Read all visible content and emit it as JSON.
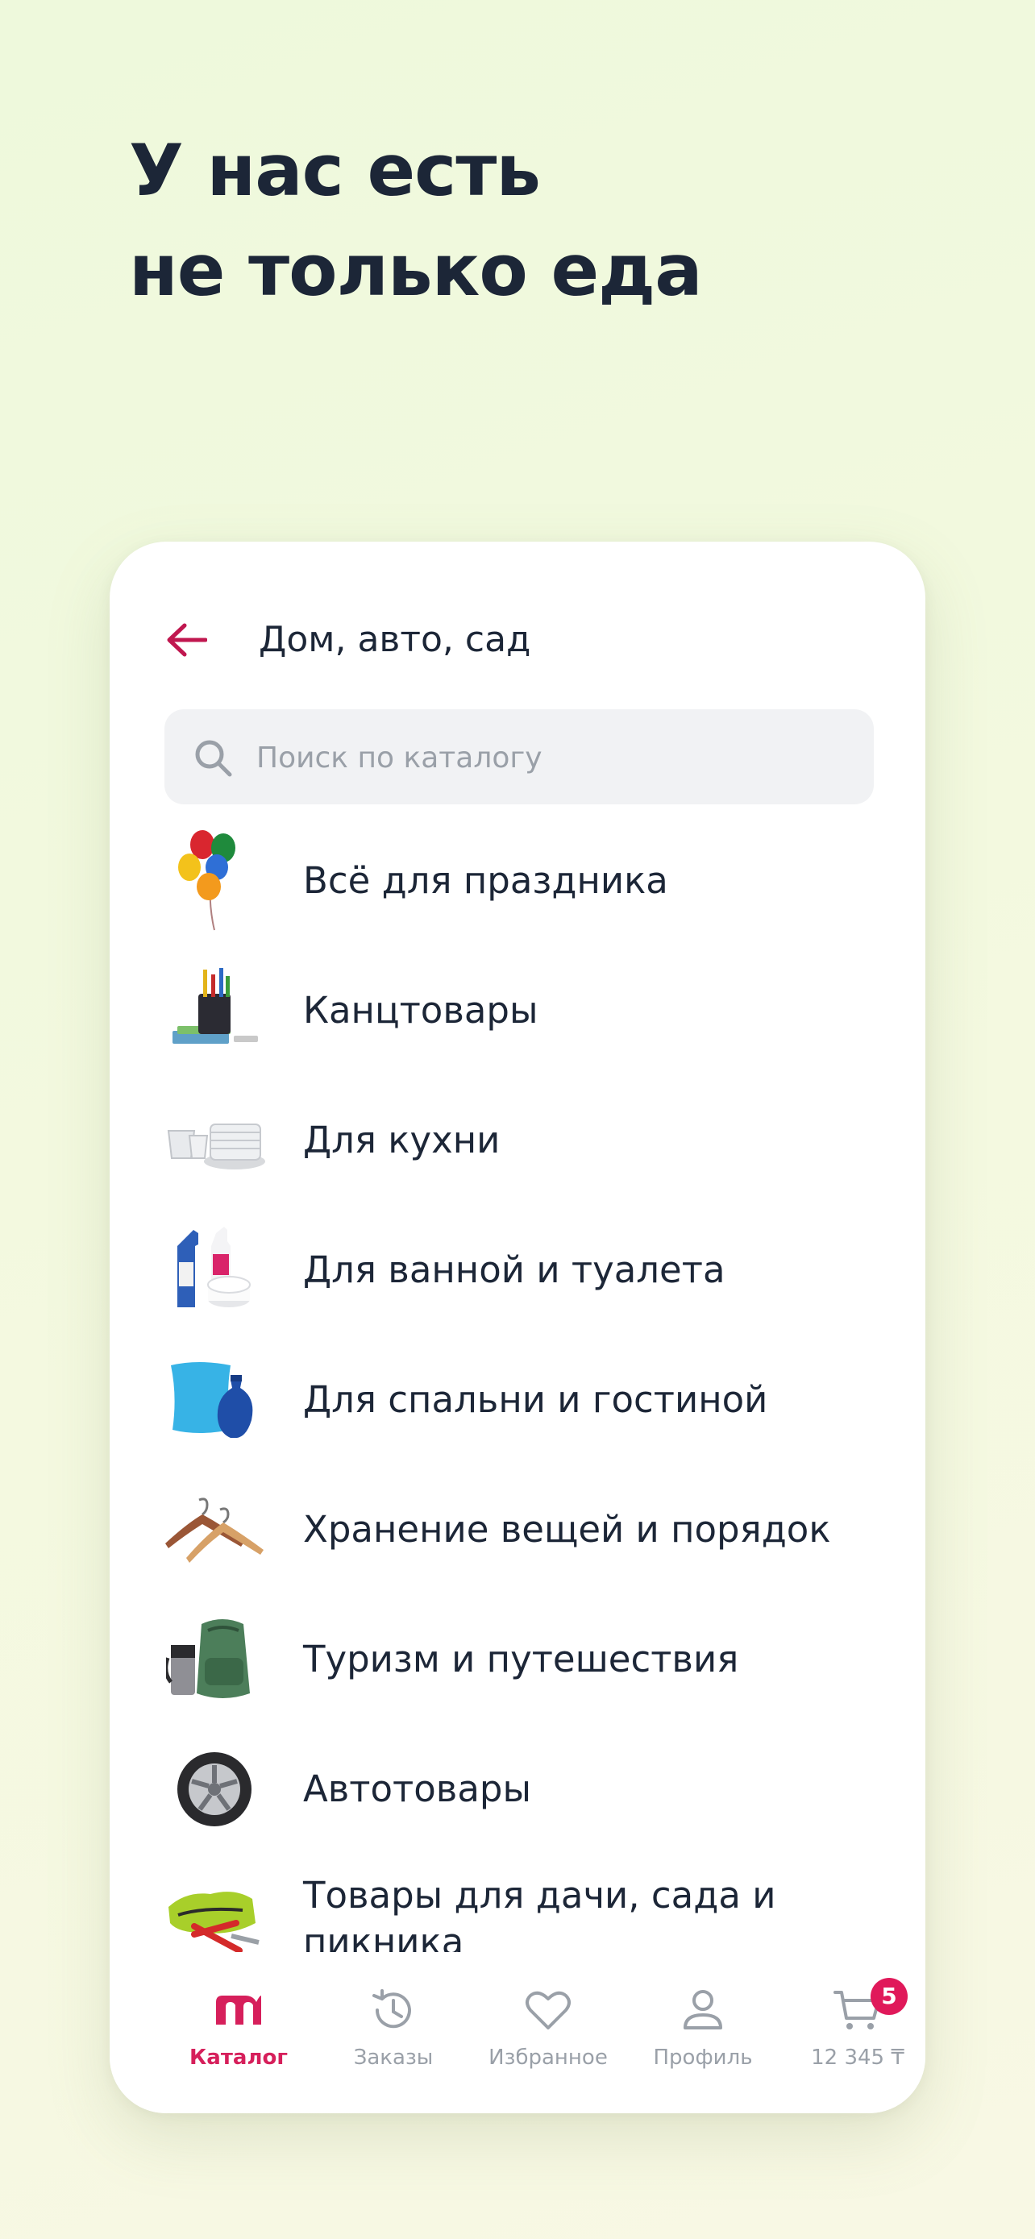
{
  "promo": {
    "line1": "У нас есть",
    "line2": "не только еда"
  },
  "header": {
    "title": "Дом, авто, сад"
  },
  "search": {
    "placeholder": "Поиск по каталогу"
  },
  "categories": [
    {
      "label": "Всё для праздника",
      "icon": "balloons-icon"
    },
    {
      "label": "Канцтовары",
      "icon": "stationery-icon"
    },
    {
      "label": "Для кухни",
      "icon": "dishes-icon"
    },
    {
      "label": "Для ванной и туалета",
      "icon": "bathroom-products-icon"
    },
    {
      "label": "Для спальни и гостиной",
      "icon": "pillow-vase-icon"
    },
    {
      "label": "Хранение вещей и порядок",
      "icon": "hangers-icon"
    },
    {
      "label": "Туризм и путешествия",
      "icon": "backpack-icon"
    },
    {
      "label": "Автотовары",
      "icon": "tire-icon"
    },
    {
      "label": "Товары для дачи, сада и пикника",
      "icon": "garden-tools-icon"
    }
  ],
  "tabbar": {
    "catalog": "Каталог",
    "orders": "Заказы",
    "favorites": "Избранное",
    "profile": "Профиль",
    "cart_total": "12 345 ₸",
    "cart_count": "5"
  },
  "colors": {
    "accent": "#d61f5b",
    "text": "#1c2637",
    "muted": "#9aa0a8"
  }
}
